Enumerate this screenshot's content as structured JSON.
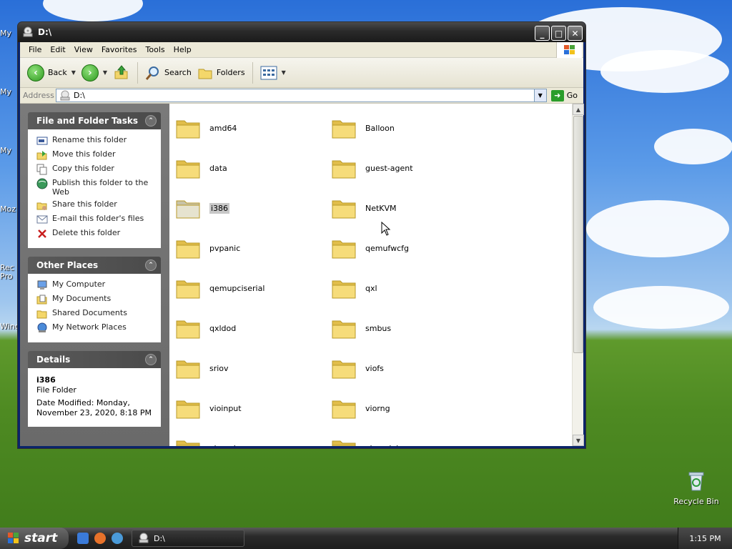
{
  "window": {
    "title": "D:\\"
  },
  "menu": {
    "items": [
      "File",
      "Edit",
      "View",
      "Favorites",
      "Tools",
      "Help"
    ]
  },
  "toolbar": {
    "back_label": "Back",
    "search_label": "Search",
    "folders_label": "Folders"
  },
  "address": {
    "label": "Address",
    "value": "D:\\",
    "go_label": "Go"
  },
  "tasks_panel": {
    "title": "File and Folder Tasks",
    "items": [
      {
        "label": "Rename this folder",
        "icon": "rename-icon"
      },
      {
        "label": "Move this folder",
        "icon": "move-icon"
      },
      {
        "label": "Copy this folder",
        "icon": "copy-icon"
      },
      {
        "label": "Publish this folder to the Web",
        "icon": "globe-icon"
      },
      {
        "label": "Share this folder",
        "icon": "share-icon"
      },
      {
        "label": "E-mail this folder's files",
        "icon": "email-icon"
      },
      {
        "label": "Delete this folder",
        "icon": "delete-icon"
      }
    ]
  },
  "places_panel": {
    "title": "Other Places",
    "items": [
      {
        "label": "My Computer",
        "icon": "computer-icon"
      },
      {
        "label": "My Documents",
        "icon": "documents-icon"
      },
      {
        "label": "Shared Documents",
        "icon": "folder-icon"
      },
      {
        "label": "My Network Places",
        "icon": "network-icon"
      }
    ]
  },
  "details_panel": {
    "title": "Details",
    "name": "i386",
    "type": "File Folder",
    "modified_line1": "Date Modified: Monday,",
    "modified_line2": "November 23, 2020, 8:18 PM"
  },
  "files": [
    {
      "name": "amd64",
      "selected": false
    },
    {
      "name": "Balloon",
      "selected": false
    },
    {
      "name": "data",
      "selected": false
    },
    {
      "name": "guest-agent",
      "selected": false
    },
    {
      "name": "i386",
      "selected": true
    },
    {
      "name": "NetKVM",
      "selected": false
    },
    {
      "name": "pvpanic",
      "selected": false
    },
    {
      "name": "qemufwcfg",
      "selected": false
    },
    {
      "name": "qemupciserial",
      "selected": false
    },
    {
      "name": "qxl",
      "selected": false
    },
    {
      "name": "qxldod",
      "selected": false
    },
    {
      "name": "smbus",
      "selected": false
    },
    {
      "name": "sriov",
      "selected": false
    },
    {
      "name": "viofs",
      "selected": false
    },
    {
      "name": "vioinput",
      "selected": false
    },
    {
      "name": "viorng",
      "selected": false
    },
    {
      "name": "vioscsi",
      "selected": false
    },
    {
      "name": "vioserial",
      "selected": false
    }
  ],
  "desktop": {
    "recycle_bin_label": "Recycle Bin",
    "stubs": [
      "My",
      "My",
      "My",
      "Moz",
      "Rec",
      "Pro",
      "Wind"
    ]
  },
  "taskbar": {
    "start_label": "start",
    "task_item_label": "D:\\",
    "clock": "1:15 PM"
  }
}
